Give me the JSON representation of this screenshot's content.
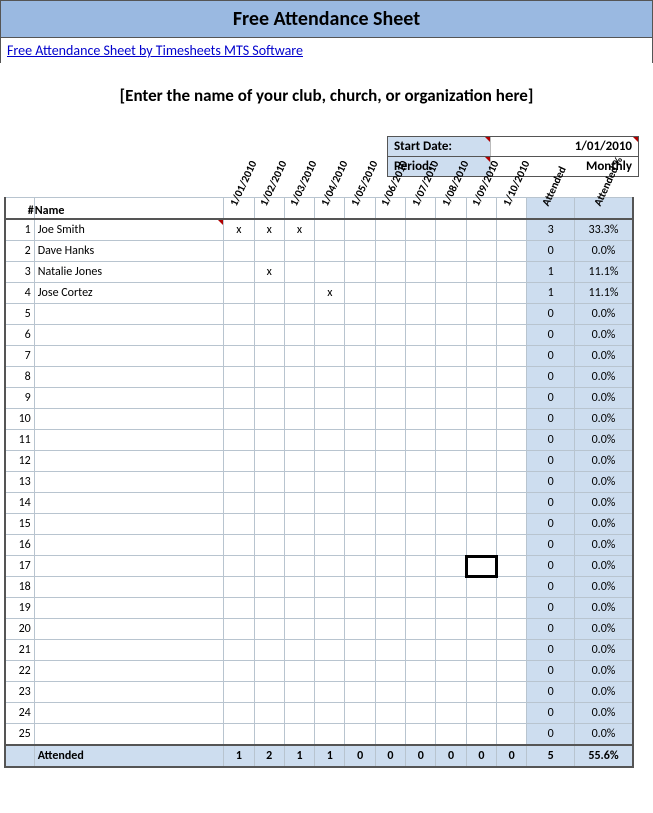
{
  "header": {
    "title": "Free Attendance Sheet",
    "link": "Free Attendance Sheet by Timesheets MTS Software",
    "subtitle": "[Enter the name of your club, church, or organization here]"
  },
  "meta": {
    "start_label": "Start Date:",
    "start_value": "1/01/2010",
    "period_label": "Period:",
    "period_value": "Monthly"
  },
  "columns": {
    "num": "#",
    "name": "Name",
    "dates": [
      "1/01/2010",
      "1/02/2010",
      "1/03/2010",
      "1/04/2010",
      "1/05/2010",
      "1/06/2010",
      "1/07/2010",
      "1/08/2010",
      "1/09/2010",
      "1/10/2010"
    ],
    "attended": "Attended",
    "attended_pct": "Attended %"
  },
  "rows": [
    {
      "n": "1",
      "name": "Joe Smith",
      "m": [
        "x",
        "x",
        "x",
        "",
        "",
        "",
        "",
        "",
        "",
        ""
      ],
      "att": "3",
      "pct": "33.3%"
    },
    {
      "n": "2",
      "name": "Dave Hanks",
      "m": [
        "",
        "",
        "",
        "",
        "",
        "",
        "",
        "",
        "",
        ""
      ],
      "att": "0",
      "pct": "0.0%"
    },
    {
      "n": "3",
      "name": "Natalie Jones",
      "m": [
        "",
        "x",
        "",
        "",
        "",
        "",
        "",
        "",
        "",
        ""
      ],
      "att": "1",
      "pct": "11.1%"
    },
    {
      "n": "4",
      "name": "Jose Cortez",
      "m": [
        "",
        "",
        "",
        "x",
        "",
        "",
        "",
        "",
        "",
        ""
      ],
      "att": "1",
      "pct": "11.1%"
    },
    {
      "n": "5",
      "name": "",
      "m": [
        "",
        "",
        "",
        "",
        "",
        "",
        "",
        "",
        "",
        ""
      ],
      "att": "0",
      "pct": "0.0%"
    },
    {
      "n": "6",
      "name": "",
      "m": [
        "",
        "",
        "",
        "",
        "",
        "",
        "",
        "",
        "",
        ""
      ],
      "att": "0",
      "pct": "0.0%"
    },
    {
      "n": "7",
      "name": "",
      "m": [
        "",
        "",
        "",
        "",
        "",
        "",
        "",
        "",
        "",
        ""
      ],
      "att": "0",
      "pct": "0.0%"
    },
    {
      "n": "8",
      "name": "",
      "m": [
        "",
        "",
        "",
        "",
        "",
        "",
        "",
        "",
        "",
        ""
      ],
      "att": "0",
      "pct": "0.0%"
    },
    {
      "n": "9",
      "name": "",
      "m": [
        "",
        "",
        "",
        "",
        "",
        "",
        "",
        "",
        "",
        ""
      ],
      "att": "0",
      "pct": "0.0%"
    },
    {
      "n": "10",
      "name": "",
      "m": [
        "",
        "",
        "",
        "",
        "",
        "",
        "",
        "",
        "",
        ""
      ],
      "att": "0",
      "pct": "0.0%"
    },
    {
      "n": "11",
      "name": "",
      "m": [
        "",
        "",
        "",
        "",
        "",
        "",
        "",
        "",
        "",
        ""
      ],
      "att": "0",
      "pct": "0.0%"
    },
    {
      "n": "12",
      "name": "",
      "m": [
        "",
        "",
        "",
        "",
        "",
        "",
        "",
        "",
        "",
        ""
      ],
      "att": "0",
      "pct": "0.0%"
    },
    {
      "n": "13",
      "name": "",
      "m": [
        "",
        "",
        "",
        "",
        "",
        "",
        "",
        "",
        "",
        ""
      ],
      "att": "0",
      "pct": "0.0%"
    },
    {
      "n": "14",
      "name": "",
      "m": [
        "",
        "",
        "",
        "",
        "",
        "",
        "",
        "",
        "",
        ""
      ],
      "att": "0",
      "pct": "0.0%"
    },
    {
      "n": "15",
      "name": "",
      "m": [
        "",
        "",
        "",
        "",
        "",
        "",
        "",
        "",
        "",
        ""
      ],
      "att": "0",
      "pct": "0.0%"
    },
    {
      "n": "16",
      "name": "",
      "m": [
        "",
        "",
        "",
        "",
        "",
        "",
        "",
        "",
        "",
        ""
      ],
      "att": "0",
      "pct": "0.0%"
    },
    {
      "n": "17",
      "name": "",
      "m": [
        "",
        "",
        "",
        "",
        "",
        "",
        "",
        "",
        "",
        ""
      ],
      "att": "0",
      "pct": "0.0%"
    },
    {
      "n": "18",
      "name": "",
      "m": [
        "",
        "",
        "",
        "",
        "",
        "",
        "",
        "",
        "",
        ""
      ],
      "att": "0",
      "pct": "0.0%"
    },
    {
      "n": "19",
      "name": "",
      "m": [
        "",
        "",
        "",
        "",
        "",
        "",
        "",
        "",
        "",
        ""
      ],
      "att": "0",
      "pct": "0.0%"
    },
    {
      "n": "20",
      "name": "",
      "m": [
        "",
        "",
        "",
        "",
        "",
        "",
        "",
        "",
        "",
        ""
      ],
      "att": "0",
      "pct": "0.0%"
    },
    {
      "n": "21",
      "name": "",
      "m": [
        "",
        "",
        "",
        "",
        "",
        "",
        "",
        "",
        "",
        ""
      ],
      "att": "0",
      "pct": "0.0%"
    },
    {
      "n": "22",
      "name": "",
      "m": [
        "",
        "",
        "",
        "",
        "",
        "",
        "",
        "",
        "",
        ""
      ],
      "att": "0",
      "pct": "0.0%"
    },
    {
      "n": "23",
      "name": "",
      "m": [
        "",
        "",
        "",
        "",
        "",
        "",
        "",
        "",
        "",
        ""
      ],
      "att": "0",
      "pct": "0.0%"
    },
    {
      "n": "24",
      "name": "",
      "m": [
        "",
        "",
        "",
        "",
        "",
        "",
        "",
        "",
        "",
        ""
      ],
      "att": "0",
      "pct": "0.0%"
    },
    {
      "n": "25",
      "name": "",
      "m": [
        "",
        "",
        "",
        "",
        "",
        "",
        "",
        "",
        "",
        ""
      ],
      "att": "0",
      "pct": "0.0%"
    }
  ],
  "footer": {
    "label": "Attended",
    "totals": [
      "1",
      "2",
      "1",
      "1",
      "0",
      "0",
      "0",
      "0",
      "0",
      "0"
    ],
    "att": "5",
    "pct": "55.6%"
  },
  "selected_cell": {
    "row": 16,
    "col": 8
  }
}
